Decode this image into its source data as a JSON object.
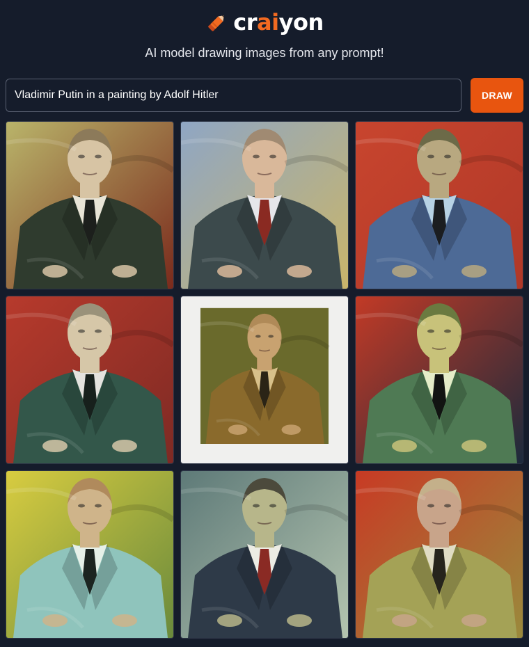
{
  "app": {
    "logo_text_before": "cr",
    "logo_text_accent": "ai",
    "logo_text_after": "yon",
    "logo_icon": "pencil-icon",
    "tagline": "AI model drawing images from any prompt!"
  },
  "prompt": {
    "value": "Vladimir Putin in a painting by Adolf Hitler",
    "placeholder": ""
  },
  "draw_button": {
    "label": "DRAW"
  },
  "colors": {
    "background": "#151c2b",
    "accent": "#e8550f",
    "text": "#ffffff"
  },
  "images": [
    {
      "bg": "#b9b46a",
      "bg2": "#7a2a1c",
      "suit": "#2f3b2e",
      "face": "#d7c4a4",
      "shirt": "#e8e4d6",
      "tie": "#1c1f1c",
      "hair": "#8c7a5a",
      "frame": false
    },
    {
      "bg": "#8fa6c4",
      "bg2": "#c9b56a",
      "suit": "#3c4a4c",
      "face": "#d9b89a",
      "shirt": "#e6e6ea",
      "tie": "#8a2a22",
      "hair": "#a08a72",
      "frame": false
    },
    {
      "bg": "#c8452e",
      "bg2": "#b03828",
      "suit": "#4d6a96",
      "face": "#b8a880",
      "shirt": "#b7d2e4",
      "tie": "#1b1d20",
      "hair": "#6c6a48",
      "frame": false
    },
    {
      "bg": "#b73a2c",
      "bg2": "#7e2a24",
      "suit": "#33574a",
      "face": "#d6c7a8",
      "shirt": "#e4e2de",
      "tie": "#17201c",
      "hair": "#9a927a",
      "frame": false
    },
    {
      "bg": "#6a6a2c",
      "bg2": "#f0f0ee",
      "suit": "#8a6a2c",
      "face": "#c8a270",
      "shirt": "#d8c08a",
      "tie": "#2a2416",
      "hair": "#b08a58",
      "frame": true
    },
    {
      "bg": "#c23a26",
      "bg2": "#1c2a3c",
      "suit": "#4f7a54",
      "face": "#c8c27a",
      "shirt": "#e4ecc8",
      "tie": "#121412",
      "hair": "#6a7a40",
      "frame": false
    },
    {
      "bg": "#d8cc40",
      "bg2": "#6a8a3c",
      "suit": "#8fc4bc",
      "face": "#cfb48a",
      "shirt": "#e6f0e8",
      "tie": "#1c2420",
      "hair": "#b08a5c",
      "frame": false
    },
    {
      "bg": "#5e7a78",
      "bg2": "#b4c4b0",
      "suit": "#2e3a48",
      "face": "#b7b68a",
      "shirt": "#ecece4",
      "tie": "#8a2a24",
      "hair": "#4c4a3c",
      "frame": false
    },
    {
      "bg": "#c83a24",
      "bg2": "#9a8a3c",
      "suit": "#a4a256",
      "face": "#c8a48a",
      "shirt": "#e0dcc4",
      "tie": "#26241c",
      "hair": "#c4b08a",
      "frame": false
    }
  ]
}
